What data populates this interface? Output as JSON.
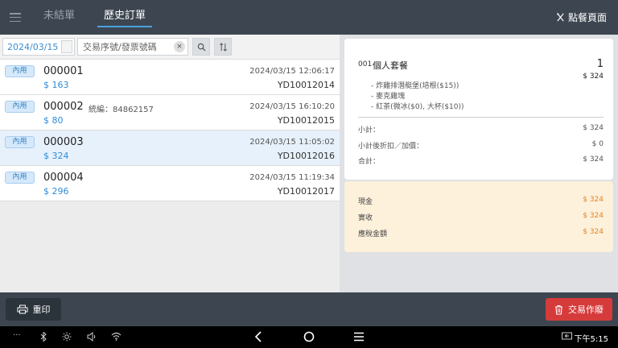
{
  "header": {
    "tabs": [
      {
        "label": "未結單",
        "active": false
      },
      {
        "label": "歷史訂單",
        "active": true
      }
    ],
    "order_page_label": "點餐頁面"
  },
  "filter": {
    "date": "2024/03/15",
    "search_placeholder": "交易序號/發票號碼",
    "clear_symbol": "×"
  },
  "orders": [
    {
      "type": "內用",
      "number": "000001",
      "tax_id": "",
      "amount": "$ 163",
      "datetime": "2024/03/15 12:06:17",
      "invoice": "YD10012014"
    },
    {
      "type": "內用",
      "number": "000002",
      "tax_id": "統編：84862157",
      "amount": "$ 80",
      "datetime": "2024/03/15 16:10:20",
      "invoice": "YD10012015"
    },
    {
      "type": "內用",
      "number": "000003",
      "tax_id": "",
      "amount": "$ 324",
      "datetime": "2024/03/15 11:05:02",
      "invoice": "YD10012016"
    },
    {
      "type": "內用",
      "number": "000004",
      "tax_id": "",
      "amount": "$ 296",
      "datetime": "2024/03/15 11:19:34",
      "invoice": "YD10012017"
    }
  ],
  "detail": {
    "item": {
      "seq": "001",
      "name": "個人套餐",
      "qty": "1",
      "price": "$ 324",
      "subitems": [
        "- 炸雞排潛艇堡(培根($15))",
        "- 麥克雞塊",
        "- 紅茶(微冰($0), 大杯($10))"
      ]
    },
    "summary": [
      {
        "label": "小計：",
        "value": "$ 324"
      },
      {
        "label": "小計後折扣／加價：",
        "value": "$ 0"
      },
      {
        "label": "合計：",
        "value": "$ 324"
      }
    ],
    "payment": [
      {
        "label": "現金",
        "value": "$ 324"
      },
      {
        "label": "實收",
        "value": "$ 324"
      },
      {
        "label": "應稅金額",
        "value": "$ 324"
      }
    ]
  },
  "actions": {
    "reprint_label": "重印",
    "void_label": "交易作廢"
  },
  "system": {
    "clock": "下午5:15",
    "more_label": "···"
  },
  "colors": {
    "header_bg": "#3d4650",
    "accent_blue": "#2f8cd8",
    "void_red": "#d63b3b",
    "payment_orange": "#e38325",
    "selected_row": "#e7f1fb"
  },
  "selected_order_index": 2
}
